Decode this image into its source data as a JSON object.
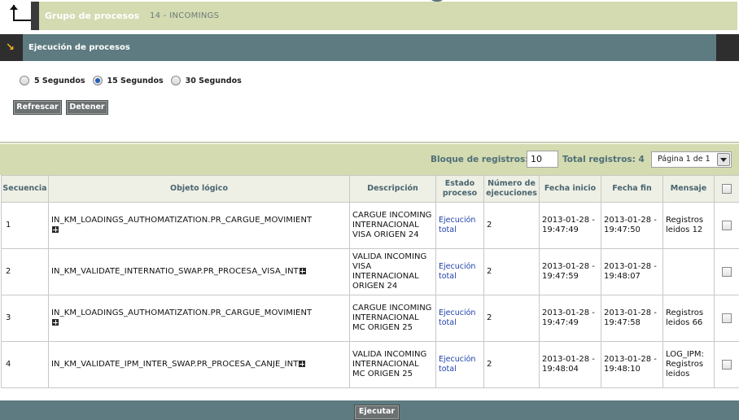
{
  "header": {
    "group_title": "Grupo de procesos",
    "group_value": "14 - INCOMINGS"
  },
  "section": {
    "title": "Ejecución de procesos"
  },
  "refresh": {
    "options": [
      {
        "label": "5 Segundos",
        "selected": false
      },
      {
        "label": "15 Segundos",
        "selected": true
      },
      {
        "label": "30 Segundos",
        "selected": false
      }
    ]
  },
  "buttons": {
    "refresh": "Refrescar",
    "stop": "Detener",
    "execute": "Ejecutar"
  },
  "grid": {
    "records_label": "Bloque de registros:",
    "records_value": "10",
    "total_label": "Total registros: 4",
    "page_select": "Página 1 de 1",
    "columns": [
      "Secuencia",
      "Objeto lógico",
      "Descripción",
      "Estado proceso",
      "Número de ejecuciones",
      "Fecha inicio",
      "Fecha fin",
      "Mensaje",
      ""
    ],
    "rows": [
      {
        "seq": "1",
        "object": "IN_KM_LOADINGS_AUTHOMATIZATION.PR_CARGUE_MOVIMIENT",
        "description": "CARGUE INCOMING INTERNACIONAL VISA ORIGEN 24",
        "status": "Ejecución total",
        "executions": "2",
        "start": "2013-01-28 - 19:47:49",
        "end": "2013-01-28 - 19:47:50",
        "message": "Registros leidos 12"
      },
      {
        "seq": "2",
        "object": "IN_KM_VALIDATE_INTERNATIO_SWAP.PR_PROCESA_VISA_INT",
        "description": "VALIDA INCOMING VISA INTERNACIONAL ORIGEN 24",
        "status": "Ejecución total",
        "executions": "2",
        "start": "2013-01-28 - 19:47:59",
        "end": "2013-01-28 - 19:48:07",
        "message": ""
      },
      {
        "seq": "3",
        "object": "IN_KM_LOADINGS_AUTHOMATIZATION.PR_CARGUE_MOVIMIENT",
        "description": "CARGUE INCOMING INTERNACIONAL MC ORIGEN 25",
        "status": "Ejecución total",
        "executions": "2",
        "start": "2013-01-28 - 19:47:49",
        "end": "2013-01-28 - 19:47:58",
        "message": "Registros leidos 66"
      },
      {
        "seq": "4",
        "object": "IN_KM_VALIDATE_IPM_INTER_SWAP.PR_PROCESA_CANJE_INT",
        "description": "VALIDA INCOMING INTERNACIONAL MC ORIGEN 25",
        "status": "Ejecución total",
        "executions": "2",
        "start": "2013-01-28 - 19:48:04",
        "end": "2013-01-28 - 19:48:10",
        "message": "LOG_IPM: Registros leidos"
      }
    ]
  },
  "icons": {
    "corner": "corner-arrow-icon",
    "section": "collapse-arrow-icon",
    "expand": "plus-icon",
    "dropdown": "chevron-down-icon"
  },
  "colors": {
    "header_band": "#d4dbb1",
    "section_bar": "#5d7b80",
    "button_gray": "#6b7070",
    "link_blue": "#1e3faa"
  }
}
